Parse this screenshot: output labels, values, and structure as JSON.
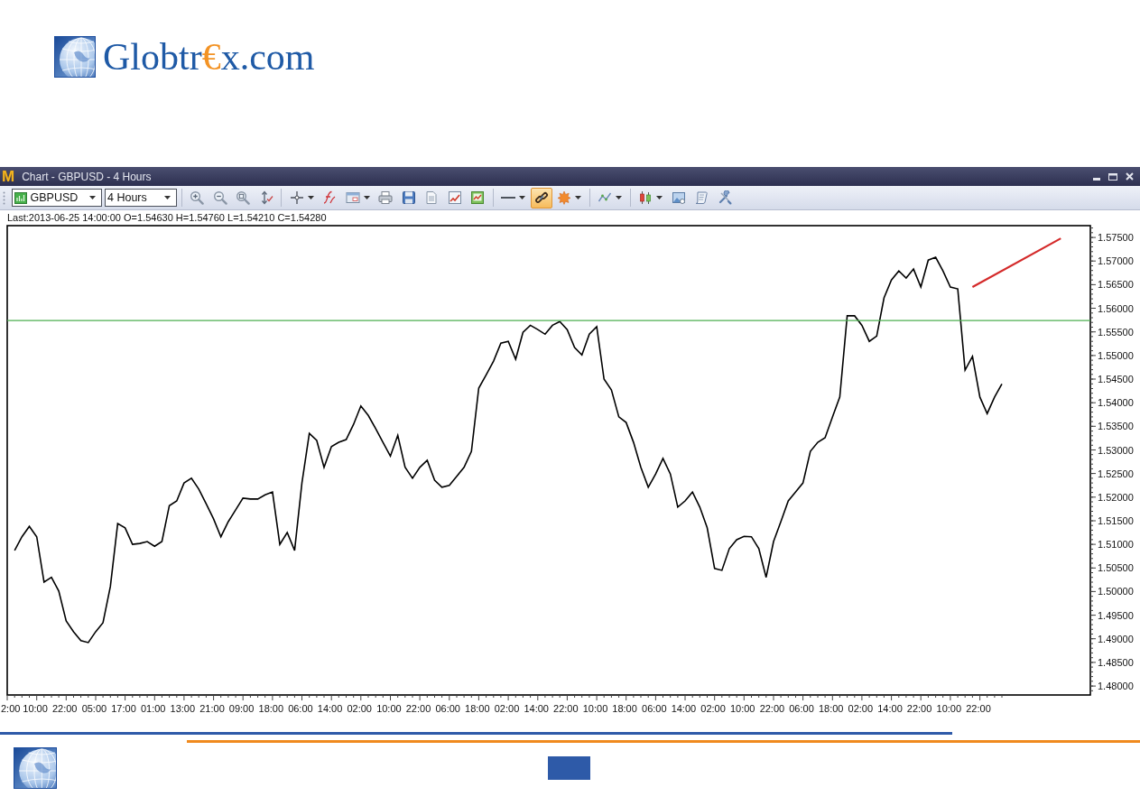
{
  "logo": {
    "segments": [
      {
        "text": "Globtr",
        "accent": false
      },
      {
        "text": "€",
        "accent": true
      },
      {
        "text": "x.com",
        "accent": false
      }
    ]
  },
  "chart_window": {
    "app_icon": "M",
    "title": "Chart - GBPUSD - 4 Hours",
    "toolbar": {
      "symbol": "GBPUSD",
      "timeframe": "4 Hours",
      "buttons": [
        {
          "selected": false
        },
        {
          "selected": false
        },
        {
          "selected": false
        },
        {
          "selected": false
        },
        {
          "selected": false
        },
        {
          "selected": false
        },
        {
          "selected": false
        },
        {
          "selected": false
        },
        {
          "selected": false
        },
        {
          "selected": false
        },
        {
          "selected": false
        },
        {
          "selected": false
        },
        {
          "selected": false
        },
        {
          "selected": true
        },
        {
          "selected": false
        },
        {
          "selected": false
        },
        {
          "selected": false
        },
        {
          "selected": false
        },
        {
          "selected": false
        },
        {
          "selected": false
        }
      ]
    },
    "info": "Last:2013-06-25 14:00:00 O=1.54630 H=1.54760 L=1.54210 C=1.54280",
    "chart": {
      "chart_data": {
        "type": "line",
        "categories": [
          "2:00",
          null,
          null,
          null,
          "10:00",
          null,
          null,
          null,
          "22:00",
          null,
          null,
          null,
          "05:00",
          null,
          null,
          null,
          "17:00",
          null,
          null,
          null,
          "01:00",
          null,
          null,
          null,
          "13:00",
          null,
          null,
          null,
          "21:00",
          null,
          null,
          null,
          "09:00",
          null,
          null,
          null,
          "18:00",
          null,
          null,
          null,
          "06:00",
          null,
          null,
          null,
          "14:00",
          null,
          null,
          null,
          "02:00",
          null,
          null,
          null,
          "10:00",
          null,
          null,
          null,
          "22:00",
          null,
          null,
          null,
          "06:00",
          null,
          null,
          null,
          "18:00",
          null,
          null,
          null,
          "02:00",
          null,
          null,
          null,
          "14:00",
          null,
          null,
          null,
          "22:00",
          null,
          null,
          null,
          "10:00",
          null,
          null,
          null,
          "18:00",
          null,
          null,
          null,
          "06:00",
          null,
          null,
          null,
          "14:00",
          null,
          null,
          null,
          "02:00",
          null,
          null,
          null,
          "10:00",
          null,
          null,
          null,
          "22:00",
          null,
          null,
          null,
          "06:00",
          null,
          null,
          null,
          "18:00",
          null,
          null,
          null,
          "02:00",
          null,
          null,
          null,
          "14:00",
          null,
          null,
          null,
          "22:00",
          null,
          null,
          null,
          "10:00",
          null,
          null,
          null,
          "22:00",
          null,
          null,
          null,
          null,
          null,
          null,
          null,
          null,
          null,
          null,
          null,
          null,
          null,
          null,
          null
        ],
        "series": [
          {
            "color": "#000000",
            "values": [
              null,
              1.5087,
              1.5116,
              1.5138,
              1.5116,
              1.502,
              1.503,
              1.5001,
              1.4938,
              1.4915,
              1.4896,
              1.4892,
              1.4915,
              1.4934,
              1.5011,
              1.5144,
              1.5135,
              1.51,
              1.5102,
              1.5106,
              1.5096,
              1.5106,
              1.5182,
              1.5192,
              1.523,
              1.524,
              1.5217,
              1.5186,
              1.5154,
              1.5116,
              1.5148,
              1.5173,
              1.5198,
              1.5196,
              1.5196,
              1.5205,
              1.5211,
              1.51,
              1.5125,
              1.5087,
              1.523,
              1.5335,
              1.532,
              1.5263,
              1.5307,
              1.5316,
              1.5322,
              1.5354,
              1.5393,
              1.5373,
              1.5345,
              1.5316,
              1.5287,
              1.5331,
              1.5263,
              1.524,
              1.5263,
              1.5278,
              1.5236,
              1.5221,
              1.5225,
              1.5244,
              1.5263,
              1.5297,
              1.5431,
              1.5459,
              1.5488,
              1.5526,
              1.553,
              1.5492,
              1.5549,
              1.5564,
              1.5555,
              1.5545,
              1.5564,
              1.5572,
              1.5555,
              1.5517,
              1.5501,
              1.5545,
              1.5561,
              1.545,
              1.5427,
              1.537,
              1.5358,
              1.5316,
              1.5263,
              1.5221,
              1.5249,
              1.5282,
              1.5249,
              1.5179,
              1.5192,
              1.5211,
              1.5179,
              1.5135,
              1.5049,
              1.5045,
              1.5091,
              1.511,
              1.5117,
              1.5116,
              1.5091,
              1.503,
              1.5106,
              1.5148,
              1.5192,
              1.5211,
              1.523,
              1.5297,
              1.5316,
              1.5326,
              1.537,
              1.5412,
              1.5584,
              1.5584,
              1.5564,
              1.553,
              1.5541,
              1.5622,
              1.566,
              1.5679,
              1.5664,
              1.5683,
              1.5645,
              1.5702,
              1.5708,
              1.5679,
              1.5645,
              1.5641,
              1.5469,
              1.5498,
              1.5412,
              1.5377,
              1.5412,
              1.544,
              null,
              null,
              null,
              null,
              null,
              null,
              null,
              null,
              null,
              null,
              null,
              null
            ]
          },
          {
            "color": "#d42a2a",
            "values": [
              null,
              null,
              null,
              null,
              null,
              null,
              null,
              null,
              null,
              null,
              null,
              null,
              null,
              null,
              null,
              null,
              null,
              null,
              null,
              null,
              null,
              null,
              null,
              null,
              null,
              null,
              null,
              null,
              null,
              null,
              null,
              null,
              null,
              null,
              null,
              null,
              null,
              null,
              null,
              null,
              null,
              null,
              null,
              null,
              null,
              null,
              null,
              null,
              null,
              null,
              null,
              null,
              null,
              null,
              null,
              null,
              null,
              null,
              null,
              null,
              null,
              null,
              null,
              null,
              null,
              null,
              null,
              null,
              null,
              null,
              null,
              null,
              null,
              null,
              null,
              null,
              null,
              null,
              null,
              null,
              null,
              null,
              null,
              null,
              null,
              null,
              null,
              null,
              null,
              null,
              null,
              null,
              null,
              null,
              null,
              null,
              null,
              null,
              null,
              null,
              null,
              null,
              null,
              null,
              null,
              null,
              null,
              null,
              null,
              null,
              null,
              null,
              null,
              null,
              null,
              null,
              null,
              null,
              null,
              null,
              null,
              null,
              null,
              null,
              null,
              null,
              null,
              null,
              null,
              null,
              null,
              1.5645,
              null,
              null,
              null,
              null,
              null,
              null,
              null,
              null,
              null,
              null,
              null,
              1.5748,
              null,
              null,
              null,
              null
            ]
          },
          {
            "color": "#4caf50",
            "values": [
              1.5574,
              null,
              null,
              null,
              null,
              null,
              null,
              null,
              null,
              null,
              null,
              null,
              null,
              null,
              null,
              null,
              null,
              null,
              null,
              null,
              null,
              null,
              null,
              null,
              null,
              null,
              null,
              null,
              null,
              null,
              null,
              null,
              null,
              null,
              null,
              null,
              null,
              null,
              null,
              null,
              null,
              null,
              null,
              null,
              null,
              null,
              null,
              null,
              null,
              null,
              null,
              null,
              null,
              null,
              null,
              null,
              null,
              null,
              null,
              null,
              null,
              null,
              null,
              null,
              null,
              null,
              null,
              null,
              null,
              null,
              null,
              null,
              null,
              null,
              null,
              null,
              null,
              null,
              null,
              null,
              null,
              null,
              null,
              null,
              null,
              null,
              null,
              null,
              null,
              null,
              null,
              null,
              null,
              null,
              null,
              null,
              null,
              null,
              null,
              null,
              null,
              null,
              null,
              null,
              null,
              null,
              null,
              null,
              null,
              null,
              null,
              null,
              null,
              null,
              null,
              null,
              null,
              null,
              null,
              null,
              null,
              null,
              null,
              null,
              null,
              null,
              null,
              null,
              null,
              null,
              null,
              null,
              null,
              null,
              null,
              null,
              null,
              null,
              null,
              null,
              null,
              null,
              null,
              null,
              null,
              null,
              null,
              1.5574
            ]
          }
        ],
        "ylim": [
          1.4781,
          1.5775
        ],
        "yticks": [
          {
            "value": 1.575,
            "label": "1.57500"
          },
          {
            "value": 1.57,
            "label": "1.57000"
          },
          {
            "value": 1.565,
            "label": "1.56500"
          },
          {
            "value": 1.56,
            "label": "1.56000"
          },
          {
            "value": 1.555,
            "label": "1.55500"
          },
          {
            "value": 1.55,
            "label": "1.55000"
          },
          {
            "value": 1.545,
            "label": "1.54500"
          },
          {
            "value": 1.54,
            "label": "1.54000"
          },
          {
            "value": 1.535,
            "label": "1.53500"
          },
          {
            "value": 1.53,
            "label": "1.53000"
          },
          {
            "value": 1.525,
            "label": "1.52500"
          },
          {
            "value": 1.52,
            "label": "1.52000"
          },
          {
            "value": 1.515,
            "label": "1.51500"
          },
          {
            "value": 1.51,
            "label": "1.51000"
          },
          {
            "value": 1.505,
            "label": "1.50500"
          },
          {
            "value": 1.5,
            "label": "1.50000"
          },
          {
            "value": 1.495,
            "label": "1.49500"
          },
          {
            "value": 1.49,
            "label": "1.49000"
          },
          {
            "value": 1.485,
            "label": "1.48500"
          },
          {
            "value": 1.48,
            "label": "1.48000"
          }
        ]
      }
    }
  }
}
